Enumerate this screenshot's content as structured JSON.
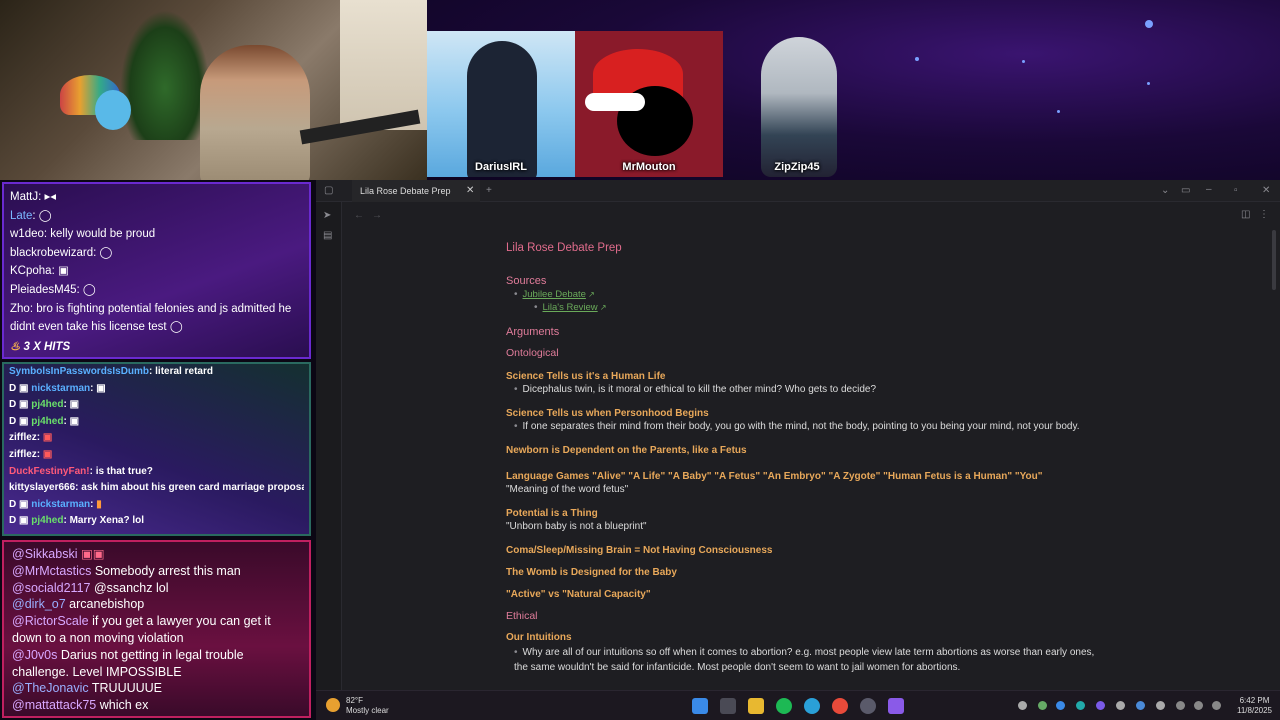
{
  "stream": {
    "participants": [
      {
        "name": "DariusIRL"
      },
      {
        "name": "MrMouton"
      },
      {
        "name": "ZipZip45"
      }
    ]
  },
  "chat_top": {
    "messages": [
      {
        "user": "MattJ",
        "text": ""
      },
      {
        "user": "Late",
        "text": ""
      },
      {
        "user": "w1deo",
        "text": "kelly would be proud"
      },
      {
        "user": "blackrobewizard",
        "text": ""
      },
      {
        "user": "KCpoha",
        "text": ""
      },
      {
        "user": "PleiadesM45",
        "text": ""
      },
      {
        "user": "Zho",
        "text": "bro is fighting potential felonies and js admitted he didnt even take his license test"
      }
    ],
    "hits_label": "3 X HITS"
  },
  "chat_mid": {
    "messages": [
      {
        "user": "SymbolsInPasswordsIsDumb",
        "text": "literal retard"
      },
      {
        "user": "nickstarman",
        "text": ""
      },
      {
        "user": "pj4hed",
        "text": ""
      },
      {
        "user": "pj4hed",
        "text": ""
      },
      {
        "user": "zifflez",
        "text": ""
      },
      {
        "user": "zifflez",
        "text": ""
      },
      {
        "user": "DuckFestinyFan!",
        "text": "is that true?"
      },
      {
        "user": "kittyslayer666",
        "text": "ask him about his green card marriage proposal"
      },
      {
        "user": "nickstarman",
        "text": ""
      },
      {
        "user": "pj4hed",
        "text": "Marry Xena? lol"
      }
    ]
  },
  "chat_bottom": {
    "messages": [
      {
        "user": "@Sikkabski",
        "text": ""
      },
      {
        "user": "@MrMctastics",
        "text": "Somebody arrest this man"
      },
      {
        "user": "@sociald2117",
        "text": "@ssanchz lol"
      },
      {
        "user": "@dirk_o7",
        "text": "arcanebishop"
      },
      {
        "user": "@RictorScale",
        "text": "if you get a lawyer you can get it down to a non moving violation"
      },
      {
        "user": "@J0v0s",
        "text": "Darius not getting in legal trouble challenge. Level IMPOSSIBLE"
      },
      {
        "user": "@TheJonavic",
        "text": "TRUUUUUE"
      },
      {
        "user": "@mattattack75",
        "text": "which ex"
      }
    ]
  },
  "editor": {
    "tab_title": "Lila Rose Debate Prep",
    "doc": {
      "title": "Lila Rose Debate Prep",
      "sources_heading": "Sources",
      "link1": "Jubilee Debate",
      "link2": "Lila's Review",
      "arguments_heading": "Arguments",
      "ontological_heading": "Ontological",
      "s1_title": "Science Tells us it's a Human Life",
      "s1_bullet": "Dicephalus twin, is it moral or ethical to kill the other mind? Who gets to decide?",
      "s2_title": "Science Tells us when Personhood Begins",
      "s2_bullet": "If one separates their mind from their body, you go with the mind, not the body, pointing to you being your mind, not your body.",
      "s3_title": "Newborn is Dependent on the Parents, like a Fetus",
      "s4_title": "Language Games \"Alive\" \"A Life\" \"A Baby\" \"A Fetus\" \"An Embryo\" \"A Zygote\" \"Human Fetus is a Human\" \"You\"",
      "s4_text": "\"Meaning of the word fetus\"",
      "s5_title": "Potential is a Thing",
      "s5_text": "\"Unborn baby is not a blueprint\"",
      "s6_title": "Coma/Sleep/Missing Brain = Not Having Consciousness",
      "s7_title": "The Womb is Designed for the Baby",
      "s8_title": "\"Active\" vs \"Natural Capacity\"",
      "ethical_heading": "Ethical",
      "s9_title": "Our Intuitions",
      "s9_bullet": "Why are all of our intuitions so off when it comes to abortion? e.g. most people view late term abortions as worse than early ones, the same wouldn't be said for infanticide. Most people don't seem to want to jail women for abortions."
    }
  },
  "taskbar": {
    "weather_temp": "82°F",
    "weather_desc": "Mostly clear",
    "time": "6:42 PM",
    "date": "11/8/2025"
  }
}
